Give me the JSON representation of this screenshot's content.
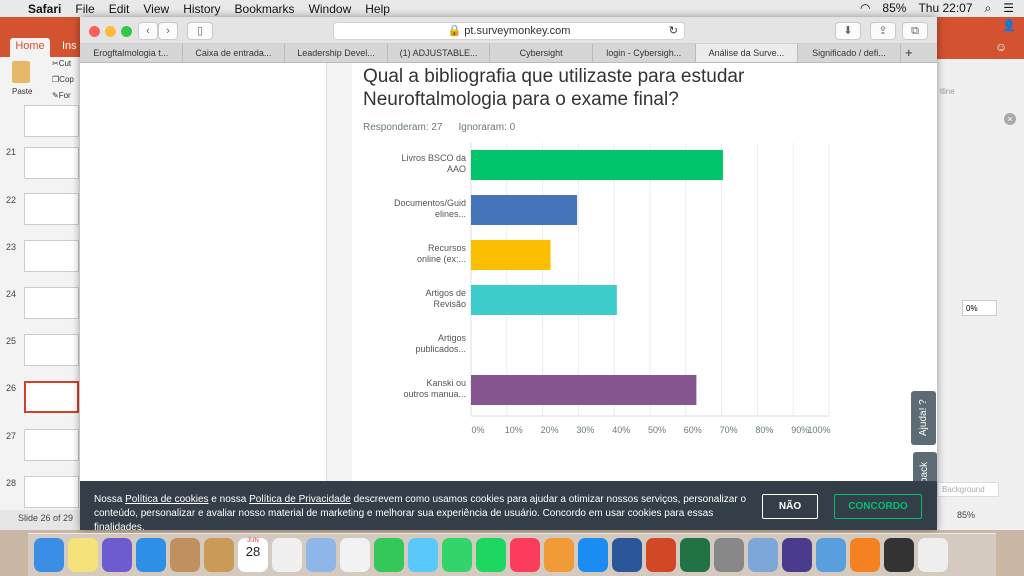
{
  "menubar": {
    "app": "Safari",
    "items": [
      "File",
      "Edit",
      "View",
      "History",
      "Bookmarks",
      "Window",
      "Help"
    ],
    "battery": "85%",
    "clock": "Thu 22:07"
  },
  "powerpoint": {
    "tab_home": "Home",
    "tab_insert": "Ins",
    "paste": "Paste",
    "cut": "Cut",
    "copy": "Cop",
    "format": "For",
    "slides": [
      "21",
      "22",
      "23",
      "24",
      "25",
      "26",
      "27",
      "28"
    ],
    "status": "Slide 26 of 29",
    "zoom": "85%",
    "right_fields": {
      "outline": "tline",
      "percent": "0%",
      "background": "Background"
    }
  },
  "safari": {
    "url": "pt.surveymonkey.com",
    "tabs": [
      "Erogftalmologia t...",
      "Caixa de entrada...",
      "Leadership Devel...",
      "(1) ADJUSTABLE...",
      "Cybersight",
      "login - Cybersigh...",
      "Análise da Surve...",
      "Significado / defi..."
    ],
    "active_tab": 6,
    "new_tab": "+"
  },
  "survey": {
    "question": "Qual a bibliografia que utilizaste para estudar Neuroftalmologia para o exame final?",
    "answered": "Responderam: 27",
    "skipped": "Ignoraram: 0",
    "help_tab": "Ajuda!",
    "feedback_tab": "back"
  },
  "chart_data": {
    "type": "bar",
    "orientation": "horizontal",
    "categories": [
      "Livros BSCO da AAO",
      "Documentos/Guid elines...",
      "Recursos online (ex:...",
      "Artigos de Revisão",
      "Artigos publicados...",
      "Kanski ou outros manua..."
    ],
    "category_lines": [
      [
        "Livros BSCO da",
        "AAO"
      ],
      [
        "Documentos/Guid",
        "elines..."
      ],
      [
        "Recursos",
        "online (ex:..."
      ],
      [
        "Artigos de",
        "Revisão"
      ],
      [
        "Artigos",
        "publicados..."
      ],
      [
        "Kanski ou",
        "outros manua..."
      ]
    ],
    "values": [
      70.37,
      29.63,
      22.22,
      40.74,
      0,
      62.96
    ],
    "colors": [
      "#00c56b",
      "#4674b8",
      "#fcbf00",
      "#3dcbcc",
      "#f05b24",
      "#84558f"
    ],
    "xlim": [
      0,
      100
    ],
    "ticks": [
      "0%",
      "10%",
      "20%",
      "30%",
      "40%",
      "50%",
      "60%",
      "70%",
      "80%",
      "90%",
      "100%"
    ],
    "grid": true
  },
  "cookie": {
    "text_1": "Nossa ",
    "link_cookies": "Política de cookies",
    "text_2": " e nossa ",
    "link_privacy": "Política de Privacidade",
    "text_3": " descrevem como usamos cookies para ajudar a otimizar nossos serviços, personalizar o conteúdo, personalizar e avaliar nosso material de marketing e melhorar sua experiência de usuário. Concordo em usar cookies para essas finalidades.",
    "decline": "NÃO",
    "accept": "CONCORDO"
  },
  "dock": {
    "calendar_month": "JUN",
    "calendar_day": "28",
    "badge": "1"
  }
}
